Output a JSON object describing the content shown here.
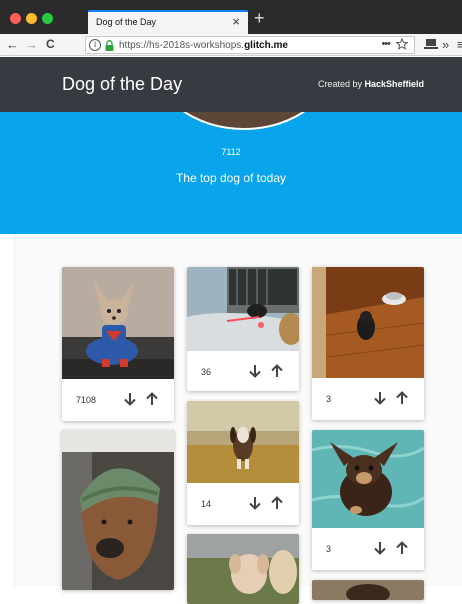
{
  "browser": {
    "tab_title": "Dog of the Day",
    "tab_close": "×",
    "new_tab": "+",
    "url_prefix": "https://hs-2018s-workshops.",
    "url_domain": "glitch.me",
    "url_dots": "•••",
    "back": "←",
    "forward": "→",
    "reload": "C",
    "overflow": "»",
    "menu": "≡"
  },
  "header": {
    "title": "Dog of the Day",
    "credit_prefix": "Created by ",
    "credit_name": "HackSheffield"
  },
  "hero": {
    "score": "7112",
    "subtitle": "The top dog of today"
  },
  "cards": [
    {
      "score": "7108"
    },
    {
      "score": "36"
    },
    {
      "score": "3"
    },
    {
      "score": "14"
    },
    {
      "score": "3"
    }
  ],
  "colors": {
    "header_bg": "#383a42",
    "hero_bg": "#08a5ec",
    "tab_accent": "#0a84ff"
  }
}
